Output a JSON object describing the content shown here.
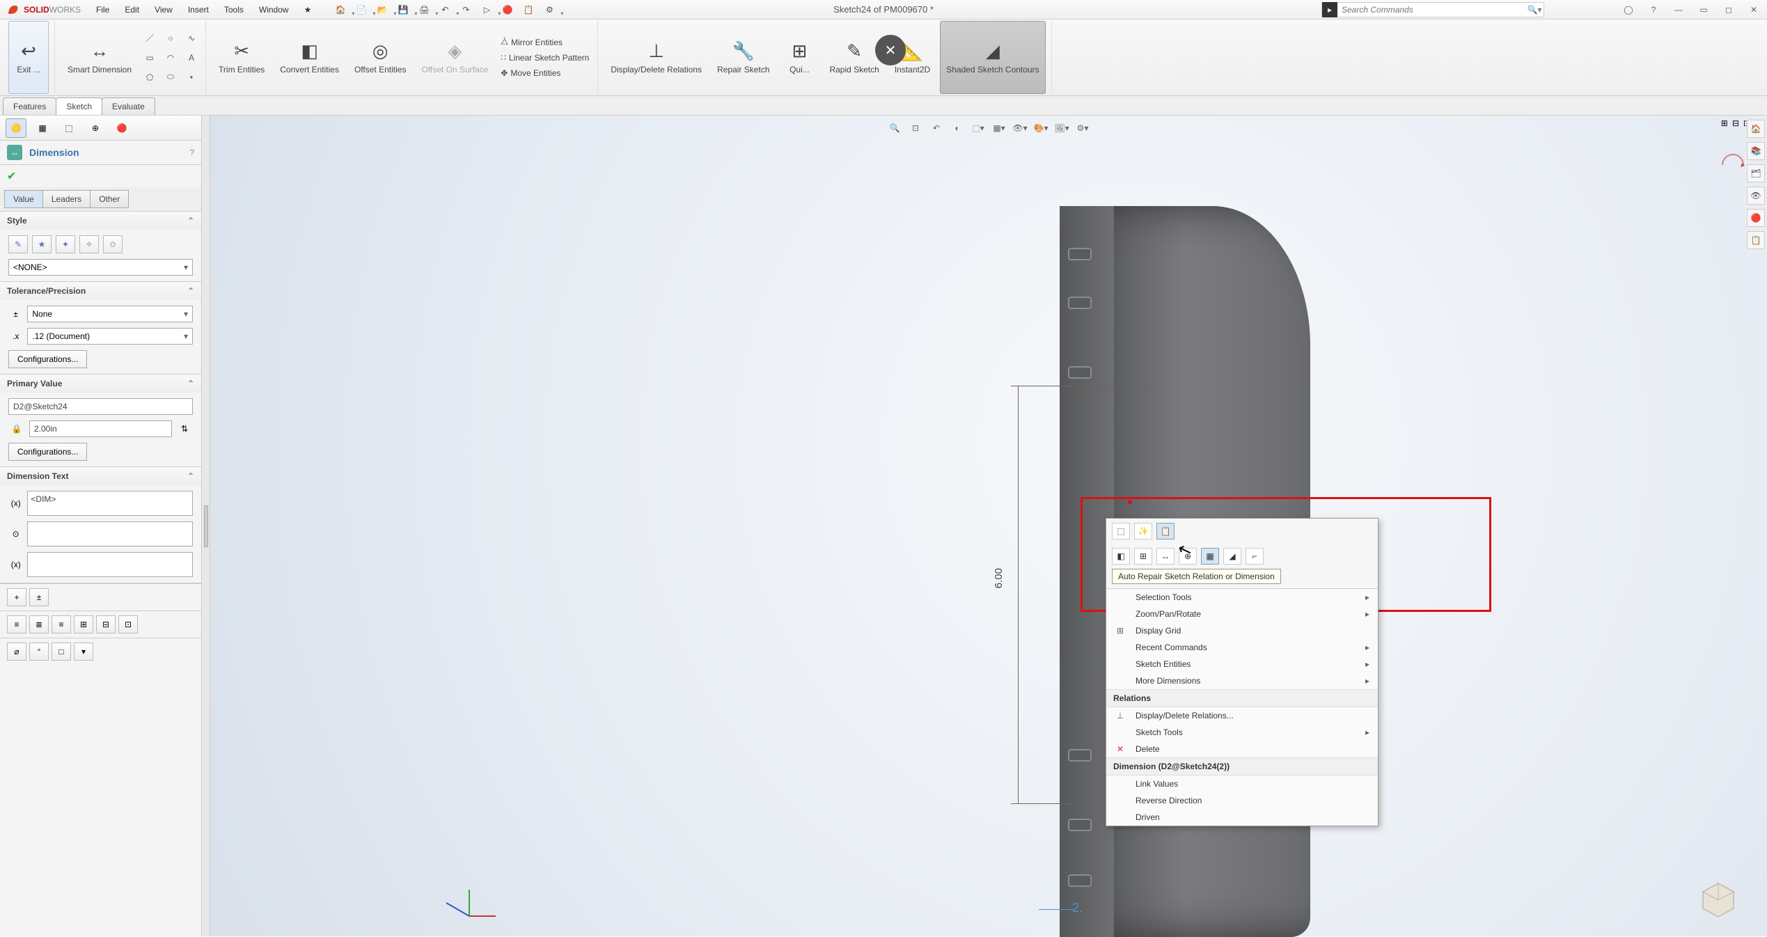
{
  "logo": {
    "brand_a": "SOLID",
    "brand_b": "WORKS"
  },
  "menus": [
    "File",
    "Edit",
    "View",
    "Insert",
    "Tools",
    "Window"
  ],
  "doc_title": "Sketch24 of PM009670 *",
  "search": {
    "placeholder": "Search Commands"
  },
  "ribbon": {
    "exit": "Exit ...",
    "smart_dim": "Smart Dimension",
    "trim": "Trim Entities",
    "convert": "Convert Entities",
    "offset": "Offset Entities",
    "offset_surface": "Offset On Surface",
    "mirror": "Mirror Entities",
    "linear": "Linear Sketch Pattern",
    "move": "Move Entities",
    "display_delete": "Display/Delete Relations",
    "repair": "Repair Sketch",
    "quick": "Qui...",
    "rapid": "Rapid Sketch",
    "instant": "Instant2D",
    "shaded": "Shaded Sketch Contours"
  },
  "tabs": [
    "Features",
    "Sketch",
    "Evaluate"
  ],
  "panel": {
    "title": "Dimension",
    "sub_tabs": [
      "Value",
      "Leaders",
      "Other"
    ],
    "style": "Style",
    "style_value": "<NONE>",
    "tol": "Tolerance/Precision",
    "tol_value": "None",
    "prec_value": ".12 (Document)",
    "config": "Configurations...",
    "pv": "Primary Value",
    "pv_name": "D2@Sketch24",
    "pv_value": "2.00in",
    "dimtext": "Dimension Text",
    "dimtext_value": "<DIM>"
  },
  "dim": {
    "v": "6.00",
    "h": "2."
  },
  "ctx": {
    "tooltip": "Auto Repair Sketch Relation or Dimension",
    "items1": [
      "Selection Tools",
      "Zoom/Pan/Rotate",
      "Display Grid",
      "Recent Commands",
      "Sketch Entities",
      "More Dimensions"
    ],
    "header1": "Relations",
    "items2": [
      "Display/Delete Relations...",
      "Sketch Tools",
      "Delete"
    ],
    "header2": "Dimension (D2@Sketch24(2))",
    "items3": [
      "Link Values",
      "Reverse Direction",
      "Driven"
    ]
  }
}
